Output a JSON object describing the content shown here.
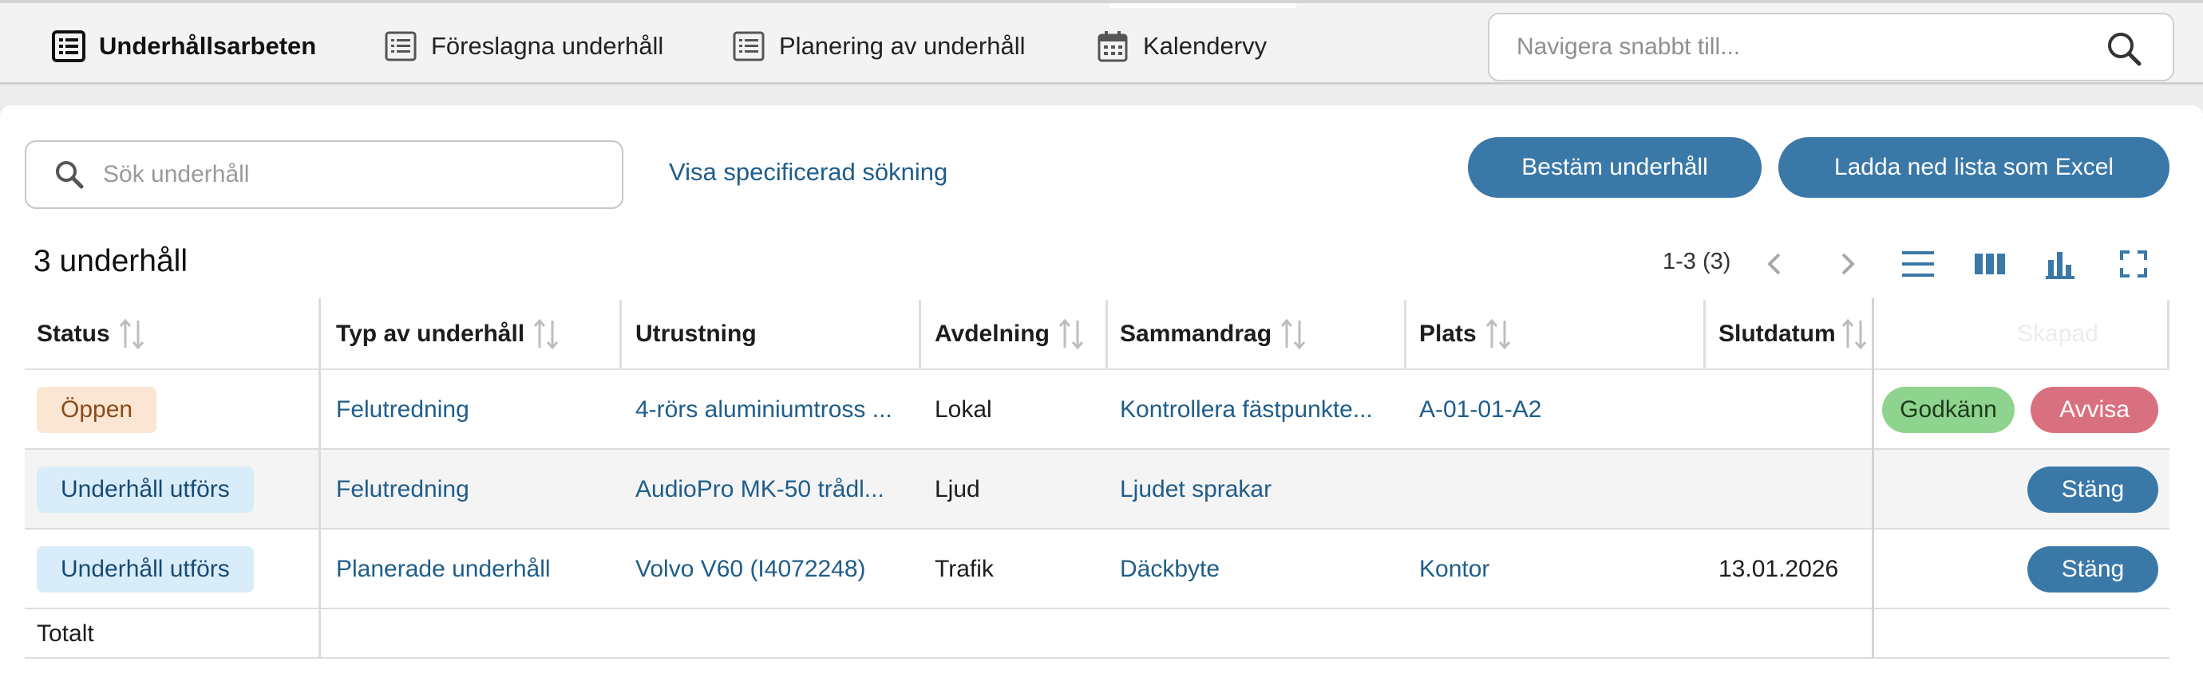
{
  "nav": {
    "tabs": [
      {
        "label": "Underhållsarbeten",
        "icon": "list-icon",
        "active": true
      },
      {
        "label": "Föreslagna underhåll",
        "icon": "list-icon",
        "active": false
      },
      {
        "label": "Planering av underhåll",
        "icon": "list-icon",
        "active": false
      },
      {
        "label": "Kalendervy",
        "icon": "calendar-icon",
        "active": false
      }
    ],
    "search_placeholder": "Navigera snabbt till..."
  },
  "toolbar": {
    "search_placeholder": "Sök underhåll",
    "advanced_link": "Visa specificerad sökning",
    "assign_button": "Bestäm underhåll",
    "excel_button": "Ladda ned lista som Excel",
    "accent_color": "#3a78a8"
  },
  "summary": {
    "count_label": "3 underhåll",
    "pager_label": "1-3 (3)"
  },
  "table": {
    "columns": [
      "Status",
      "Typ av underhåll",
      "Utrustning",
      "Avdelning",
      "Sammandrag",
      "Plats",
      "Slutdatum",
      "Skapad"
    ],
    "rows": [
      {
        "status": "Öppen",
        "status_kind": "open",
        "type": "Felutredning",
        "equipment": "4-rörs aluminiumtross ...",
        "department": "Lokal",
        "summary": "Kontrollera fästpunkte...",
        "location": "A-01-01-A2",
        "end_date": "",
        "actions": [
          "Godkänn",
          "Avvisa"
        ]
      },
      {
        "status": "Underhåll utförs",
        "status_kind": "work",
        "type": "Felutredning",
        "equipment": "AudioPro MK-50 trådl...",
        "department": "Ljud",
        "summary": "Ljudet sprakar",
        "location": "",
        "end_date": "",
        "actions": [
          "Stäng"
        ]
      },
      {
        "status": "Underhåll utförs",
        "status_kind": "work",
        "type": "Planerade underhåll",
        "equipment": "Volvo V60 (I4072248)",
        "department": "Trafik",
        "summary": "Däckbyte",
        "location": "Kontor",
        "end_date": "13.01.2026",
        "actions": [
          "Stäng"
        ]
      }
    ],
    "total_label": "Totalt"
  }
}
